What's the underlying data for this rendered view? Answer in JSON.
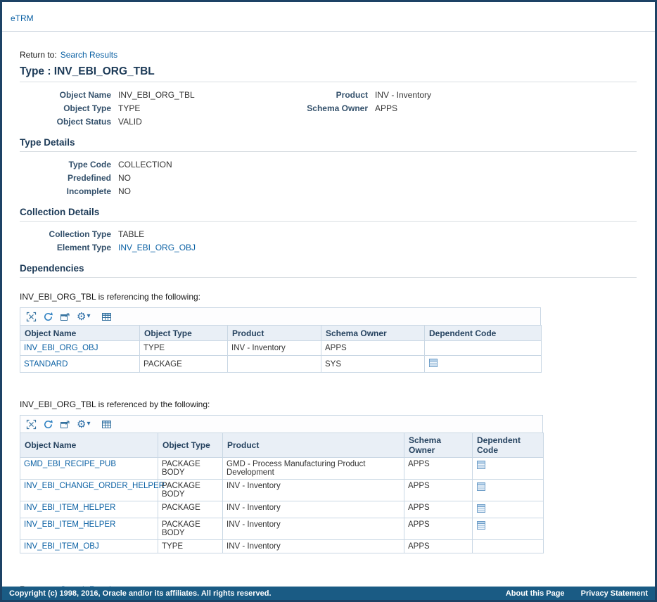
{
  "colors": {
    "link": "#0b61a4",
    "heading": "#1c3a57",
    "label": "#33506b",
    "table_header_bg": "#e9eff6",
    "table_border": "#c9d7e4",
    "footer_bg": "#1a5b84",
    "frame_border": "#1d4265"
  },
  "topbar": {
    "brand": "eTRM"
  },
  "return_to": {
    "label": "Return to:",
    "link": "Search Results"
  },
  "page": {
    "title": "Type : INV_EBI_ORG_TBL"
  },
  "object_info": {
    "object_name": {
      "label": "Object Name",
      "value": "INV_EBI_ORG_TBL"
    },
    "object_type": {
      "label": "Object Type",
      "value": "TYPE"
    },
    "object_status": {
      "label": "Object Status",
      "value": "VALID"
    },
    "product": {
      "label": "Product",
      "value": "INV - Inventory"
    },
    "schema_owner": {
      "label": "Schema Owner",
      "value": "APPS"
    }
  },
  "type_details": {
    "title": "Type Details",
    "type_code": {
      "label": "Type Code",
      "value": "COLLECTION"
    },
    "predefined": {
      "label": "Predefined",
      "value": "NO"
    },
    "incomplete": {
      "label": "Incomplete",
      "value": "NO"
    }
  },
  "collection_details": {
    "title": "Collection Details",
    "collection_type": {
      "label": "Collection Type",
      "value": "TABLE"
    },
    "element_type": {
      "label": "Element Type",
      "value": "INV_EBI_ORG_OBJ"
    }
  },
  "dependencies": {
    "title": "Dependencies",
    "toolbar_icons": [
      "select-all-icon",
      "refresh-icon",
      "detach-icon",
      "gear-menu-icon",
      "freeze-columns-icon"
    ],
    "referencing": {
      "caption": "INV_EBI_ORG_TBL is referencing the following:",
      "columns": {
        "object_name": "Object Name",
        "object_type": "Object Type",
        "product": "Product",
        "schema_owner": "Schema Owner",
        "dependent_code": "Dependent Code"
      },
      "rows": [
        {
          "object_name": "INV_EBI_ORG_OBJ",
          "object_type": "TYPE",
          "product": "INV - Inventory",
          "schema_owner": "APPS"
        },
        {
          "object_name": "STANDARD",
          "object_type": "PACKAGE",
          "product": "",
          "schema_owner": "SYS"
        }
      ]
    },
    "referenced_by": {
      "caption": "INV_EBI_ORG_TBL is referenced by the following:",
      "columns": {
        "object_name": "Object Name",
        "object_type": "Object Type",
        "product": "Product",
        "schema_owner": "Schema Owner",
        "dependent_code": "Dependent Code"
      },
      "rows": [
        {
          "object_name": "GMD_EBI_RECIPE_PUB",
          "object_type": "PACKAGE BODY",
          "product": "GMD - Process Manufacturing Product Development",
          "schema_owner": "APPS"
        },
        {
          "object_name": "INV_EBI_CHANGE_ORDER_HELPER",
          "object_type": "PACKAGE BODY",
          "product": "INV - Inventory",
          "schema_owner": "APPS"
        },
        {
          "object_name": "INV_EBI_ITEM_HELPER",
          "object_type": "PACKAGE",
          "product": "INV - Inventory",
          "schema_owner": "APPS"
        },
        {
          "object_name": "INV_EBI_ITEM_HELPER",
          "object_type": "PACKAGE BODY",
          "product": "INV - Inventory",
          "schema_owner": "APPS"
        },
        {
          "object_name": "INV_EBI_ITEM_OBJ",
          "object_type": "TYPE",
          "product": "INV - Inventory",
          "schema_owner": "APPS"
        }
      ]
    }
  },
  "footer": {
    "copyright": "Copyright (c) 1998, 2016, Oracle and/or its affiliates. All rights reserved.",
    "about_link": "About this Page",
    "privacy_link": "Privacy Statement"
  }
}
